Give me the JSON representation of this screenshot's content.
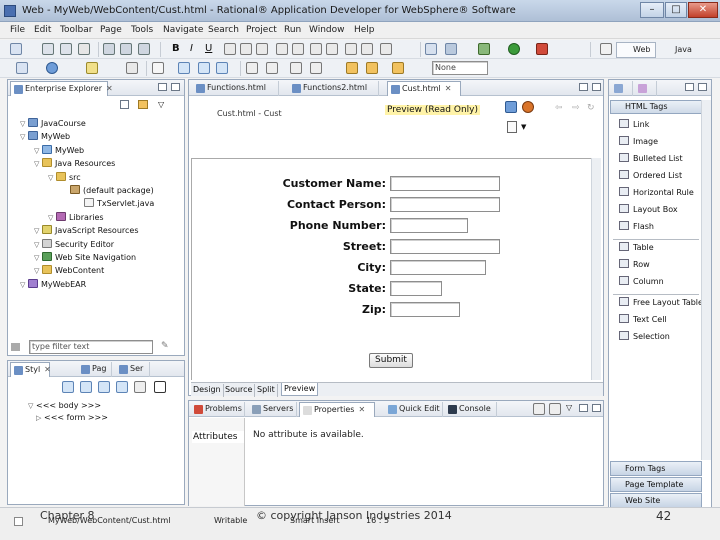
{
  "window": {
    "title": "Web - MyWeb/WebContent/Cust.html - Rational® Application Developer for WebSphere® Software",
    "buttons": {
      "minimize": "–",
      "maximize": "□",
      "close": "✕"
    }
  },
  "menubar": [
    "File",
    "Edit",
    "Toolbar",
    "Page",
    "Tools",
    "Navigate",
    "Search",
    "Project",
    "Run",
    "Window",
    "Help"
  ],
  "toolbar": {
    "font_field_value": "None",
    "perspectives": [
      "Web",
      "Java"
    ]
  },
  "explorer": {
    "tab_label": "Enterprise Explorer",
    "tree": [
      {
        "label": "JavaCourse",
        "depth": 0,
        "icon": "project-icon"
      },
      {
        "label": "MyWeb",
        "depth": 0,
        "icon": "project-icon"
      },
      {
        "label": "MyWeb",
        "depth": 1,
        "icon": "web-project-icon"
      },
      {
        "label": "Java Resources",
        "depth": 1,
        "icon": "folder-icon"
      },
      {
        "label": "src",
        "depth": 2,
        "icon": "folder-icon"
      },
      {
        "label": "(default package)",
        "depth": 3,
        "icon": "package-icon"
      },
      {
        "label": "TxServlet.java",
        "depth": 4,
        "icon": "java-file-icon"
      },
      {
        "label": "Libraries",
        "depth": 2,
        "icon": "library-icon"
      },
      {
        "label": "JavaScript Resources",
        "depth": 1,
        "icon": "javascript-icon"
      },
      {
        "label": "Security Editor",
        "depth": 1,
        "icon": "security-icon"
      },
      {
        "label": "Web Site Navigation",
        "depth": 1,
        "icon": "navigation-icon"
      },
      {
        "label": "WebContent",
        "depth": 1,
        "icon": "folder-icon"
      },
      {
        "label": "MyWebEAR",
        "depth": 0,
        "icon": "ear-project-icon"
      }
    ],
    "filter_placeholder": "type filter text"
  },
  "outline": {
    "tabs": [
      "Styl",
      "Pag",
      "Ser"
    ],
    "tree": [
      "<<< body >>>",
      "<<< form >>>"
    ]
  },
  "editor": {
    "tabs": [
      "Functions.html",
      "Functions2.html",
      "Cust.html"
    ],
    "header_label": "Cust.html - Cust",
    "preview_label": "Preview (Read Only)",
    "form": {
      "fields": [
        {
          "label": "Customer Name:"
        },
        {
          "label": "Contact Person:"
        },
        {
          "label": "Phone Number:"
        },
        {
          "label": "Street:"
        },
        {
          "label": "City:"
        },
        {
          "label": "State:"
        },
        {
          "label": "Zip:"
        }
      ],
      "submit_label": "Submit"
    },
    "bottom_tabs": [
      "Design",
      "Source",
      "Split",
      "Preview"
    ]
  },
  "palette": {
    "tabs": [
      "HTML Tags"
    ],
    "html_items": [
      "Link",
      "Image",
      "Bulleted List",
      "Ordered List",
      "Horizontal Rule",
      "Layout Box",
      "Flash"
    ],
    "table_items": [
      "Table",
      "Row",
      "Column"
    ],
    "table_tool_items": [
      "Free Layout Table",
      "Text Cell",
      "Selection"
    ],
    "drawers": [
      "Form Tags",
      "Page Template",
      "Web Site Navigation"
    ]
  },
  "properties": {
    "tabs": [
      "Problems",
      "Servers",
      "Properties",
      "Quick Edit",
      "Console"
    ],
    "section_label": "Attributes",
    "message": "No attribute is available."
  },
  "statusbar": {
    "path": "MyWeb/WebContent/Cust.html",
    "mode": "Writable",
    "insert_mode": "Smart Insert",
    "position": "16 : 5"
  },
  "overlay": {
    "left": "Chapter 8",
    "center": "© copyright Janson Industries 2014",
    "right": "42"
  },
  "colors": {
    "accent": "#7a9fd1",
    "panel_border": "#9aa9bd",
    "title_gradient_top": "#c9d8ea"
  }
}
